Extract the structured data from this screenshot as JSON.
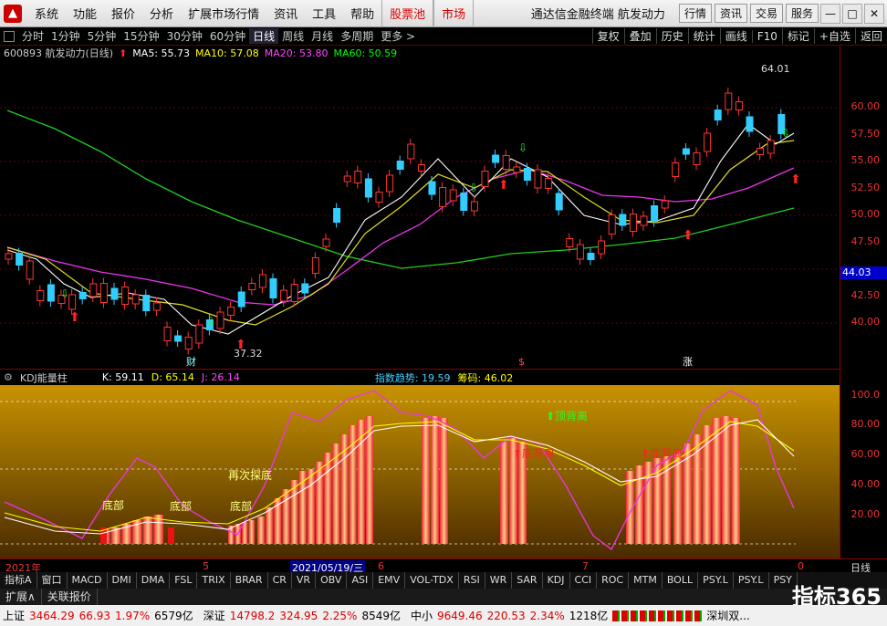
{
  "menu": {
    "items": [
      "系统",
      "功能",
      "报价",
      "分析",
      "扩展市场行情",
      "资讯",
      "工具",
      "帮助"
    ],
    "red_items": [
      "股票池",
      "市场"
    ],
    "window_title": "通达信金融终端  航发动力",
    "right_buttons": [
      "行情",
      "资讯",
      "交易",
      "服务"
    ]
  },
  "periods": [
    "分时",
    "1分钟",
    "5分钟",
    "15分钟",
    "30分钟",
    "60分钟",
    "日线",
    "周线",
    "月线",
    "多周期",
    "更多 >"
  ],
  "active_period": "日线",
  "tools": [
    "复权",
    "叠加",
    "历史",
    "统计",
    "画线",
    "F10",
    "标记",
    "+自选",
    "返回"
  ],
  "chart_info": {
    "stock": "600893 航发动力(日线)",
    "ma5": "MA5: 55.73",
    "ma10": "MA10: 57.08",
    "ma20": "MA20: 53.80",
    "ma60": "MA60: 50.59",
    "colors": {
      "ma5": "#ffffff",
      "ma10": "#ffff00",
      "ma20": "#ff40ff",
      "ma60": "#00ff00"
    }
  },
  "price_axis": {
    "ticks": [
      "60.00",
      "57.50",
      "55.00",
      "52.50",
      "50.00",
      "47.50",
      "45.00",
      "42.50",
      "40.00"
    ],
    "current": "44.03"
  },
  "annotations": {
    "high": "64.01",
    "low": "37.32",
    "cai": "财",
    "s": "$",
    "zhang": "涨"
  },
  "kdj": {
    "title": "KDJ能量柱",
    "k": "K: 59.11",
    "d": "D: 65.14",
    "j": "J: 26.14",
    "trend": "指数趋势: 19.59",
    "chips": "筹码: 46.02",
    "labels": [
      "底部",
      "底部",
      "底部",
      "再次探底",
      "顶背离",
      "底背离",
      "底背离"
    ],
    "ticks": [
      "100.0",
      "80.00",
      "60.00",
      "40.00",
      "20.00"
    ]
  },
  "dates": {
    "y2021": "2021年",
    "m5": "5",
    "sel": "2021/05/19/三",
    "m6": "6",
    "m7": "7",
    "m0": "0",
    "right": "日线"
  },
  "indicators": [
    "指标A",
    "窗口",
    "MACD",
    "DMI",
    "DMA",
    "FSL",
    "TRIX",
    "BRAR",
    "CR",
    "VR",
    "OBV",
    "ASI",
    "EMV",
    "VOL-TDX",
    "RSI",
    "WR",
    "SAR",
    "KDJ",
    "CCI",
    "ROC",
    "MTM",
    "BOLL",
    "PSY.L",
    "PSY.L",
    "PSY"
  ],
  "bottom_tabs": [
    "扩展∧",
    "关联报价"
  ],
  "status": {
    "sh_label": "上证",
    "sh_val": "3464.29",
    "sh_chg": "66.93",
    "sh_pct": "1.97%",
    "sh_amt": "6579亿",
    "sz_label": "深证",
    "sz_val": "14798.2",
    "sz_chg": "324.95",
    "sz_pct": "2.25%",
    "sz_amt": "8549亿",
    "zx_label": "中小",
    "zx_val": "9649.46",
    "zx_chg": "220.53",
    "zx_pct": "2.34%",
    "zx_amt": "1218亿",
    "extra": "深圳双..."
  },
  "brand": "指标365"
}
